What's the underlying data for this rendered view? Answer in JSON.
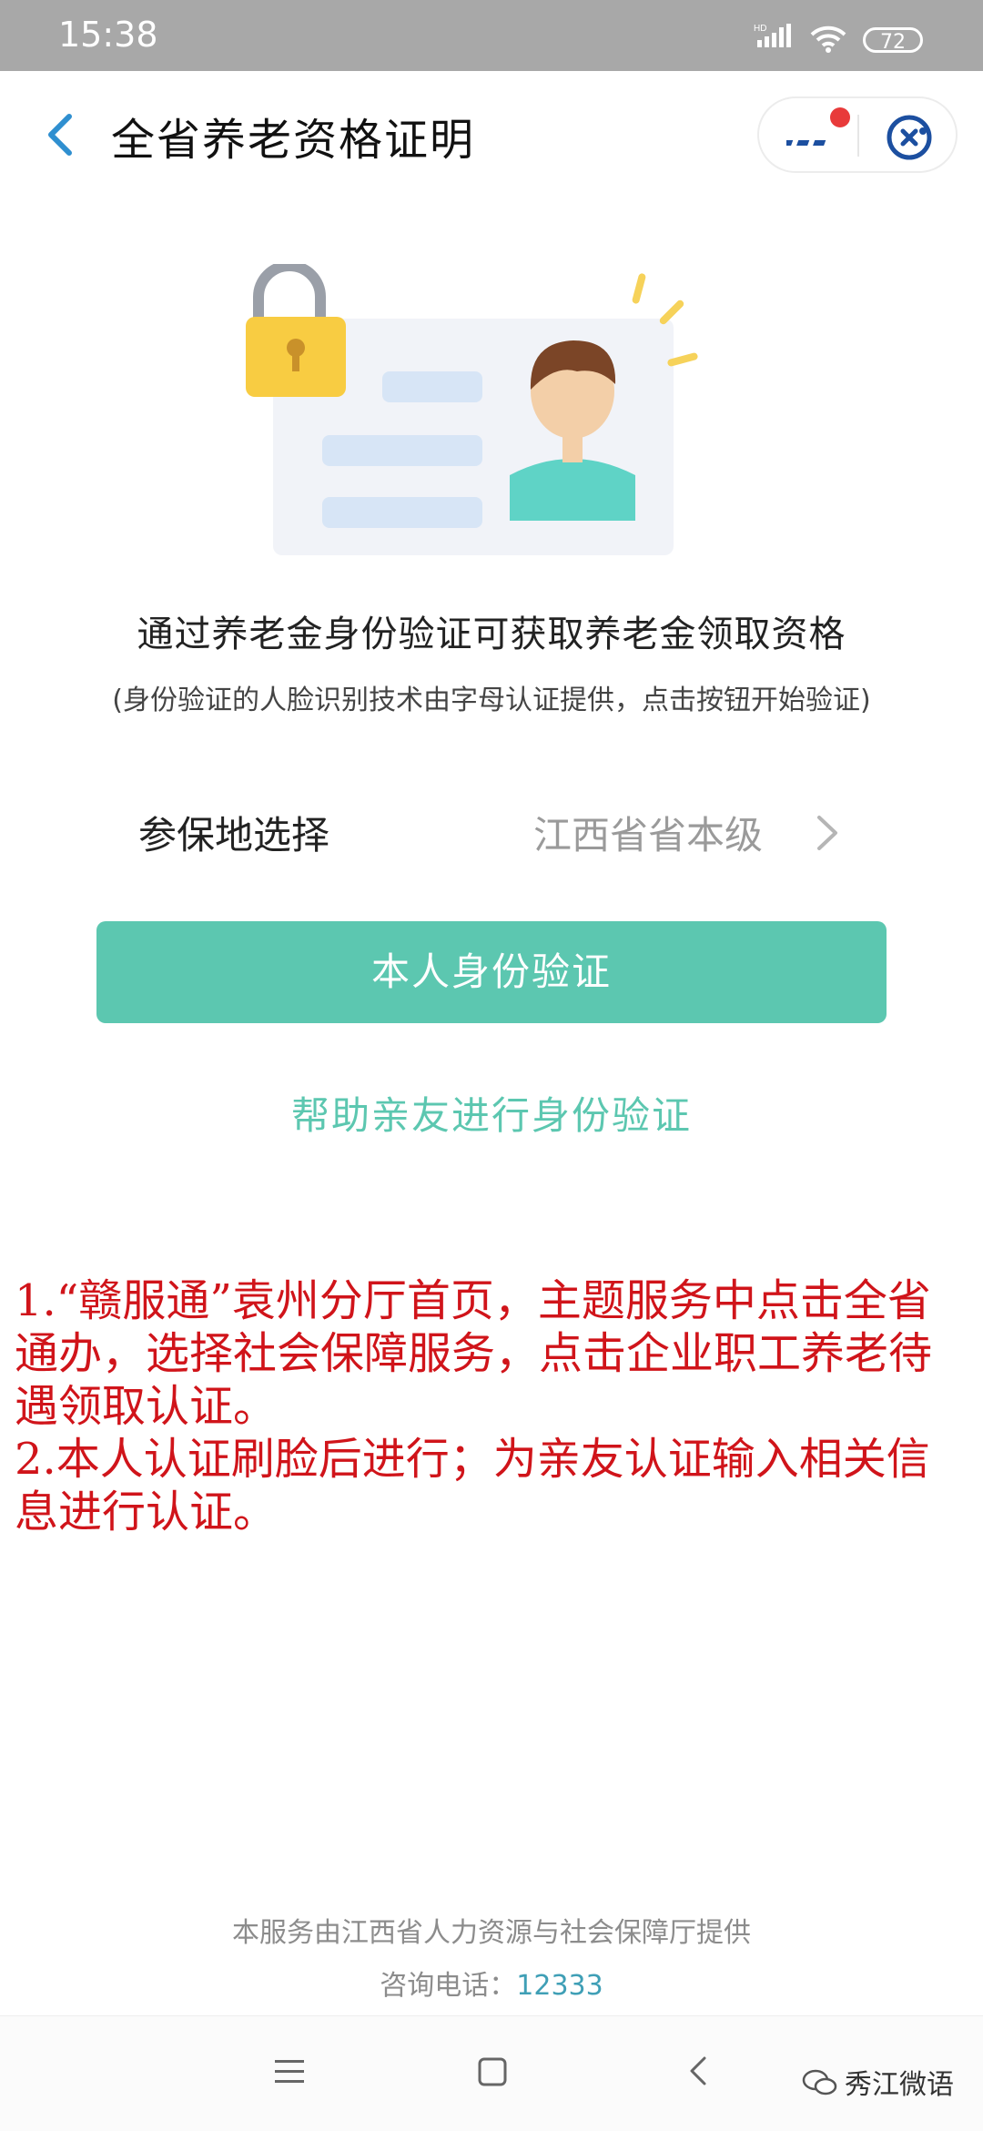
{
  "status_bar": {
    "time": "15:38",
    "network": "HD",
    "battery": "72",
    "icons": [
      "signal-icon",
      "wifi-icon",
      "battery-icon"
    ]
  },
  "nav": {
    "title": "全省养老资格证明",
    "back_icon": "chevron-left-icon",
    "more_icon": "more-dots-icon",
    "close_icon": "close-target-icon"
  },
  "intro": {
    "title": "通过养老金身份验证可获取养老金领取资格",
    "subtitle": "(身份验证的人脸识别技术由字母认证提供，点击按钮开始验证)"
  },
  "region": {
    "label": "参保地选择",
    "value": "江西省省本级"
  },
  "actions": {
    "primary": "本人身份验证",
    "secondary": "帮助亲友进行身份验证"
  },
  "note": {
    "line1": "1.“赣服通”袁州分厅首页，主题服务中点击全省通办，选择社会保障服务，点击企业职工养老待遇领取认证。",
    "line2": "2.本人认证刷脸后进行；为亲友认证输入相关信息进行认证。"
  },
  "footer": {
    "provider": "本服务由江西省人力资源与社会保障厅提供",
    "phone_label": "咨询电话：",
    "phone_number": "12333"
  },
  "watermark": {
    "text": "秀江微语"
  },
  "colors": {
    "accent": "#5cc7b0",
    "note_red": "#d0141a",
    "nav_blue": "#2f8fd0"
  }
}
